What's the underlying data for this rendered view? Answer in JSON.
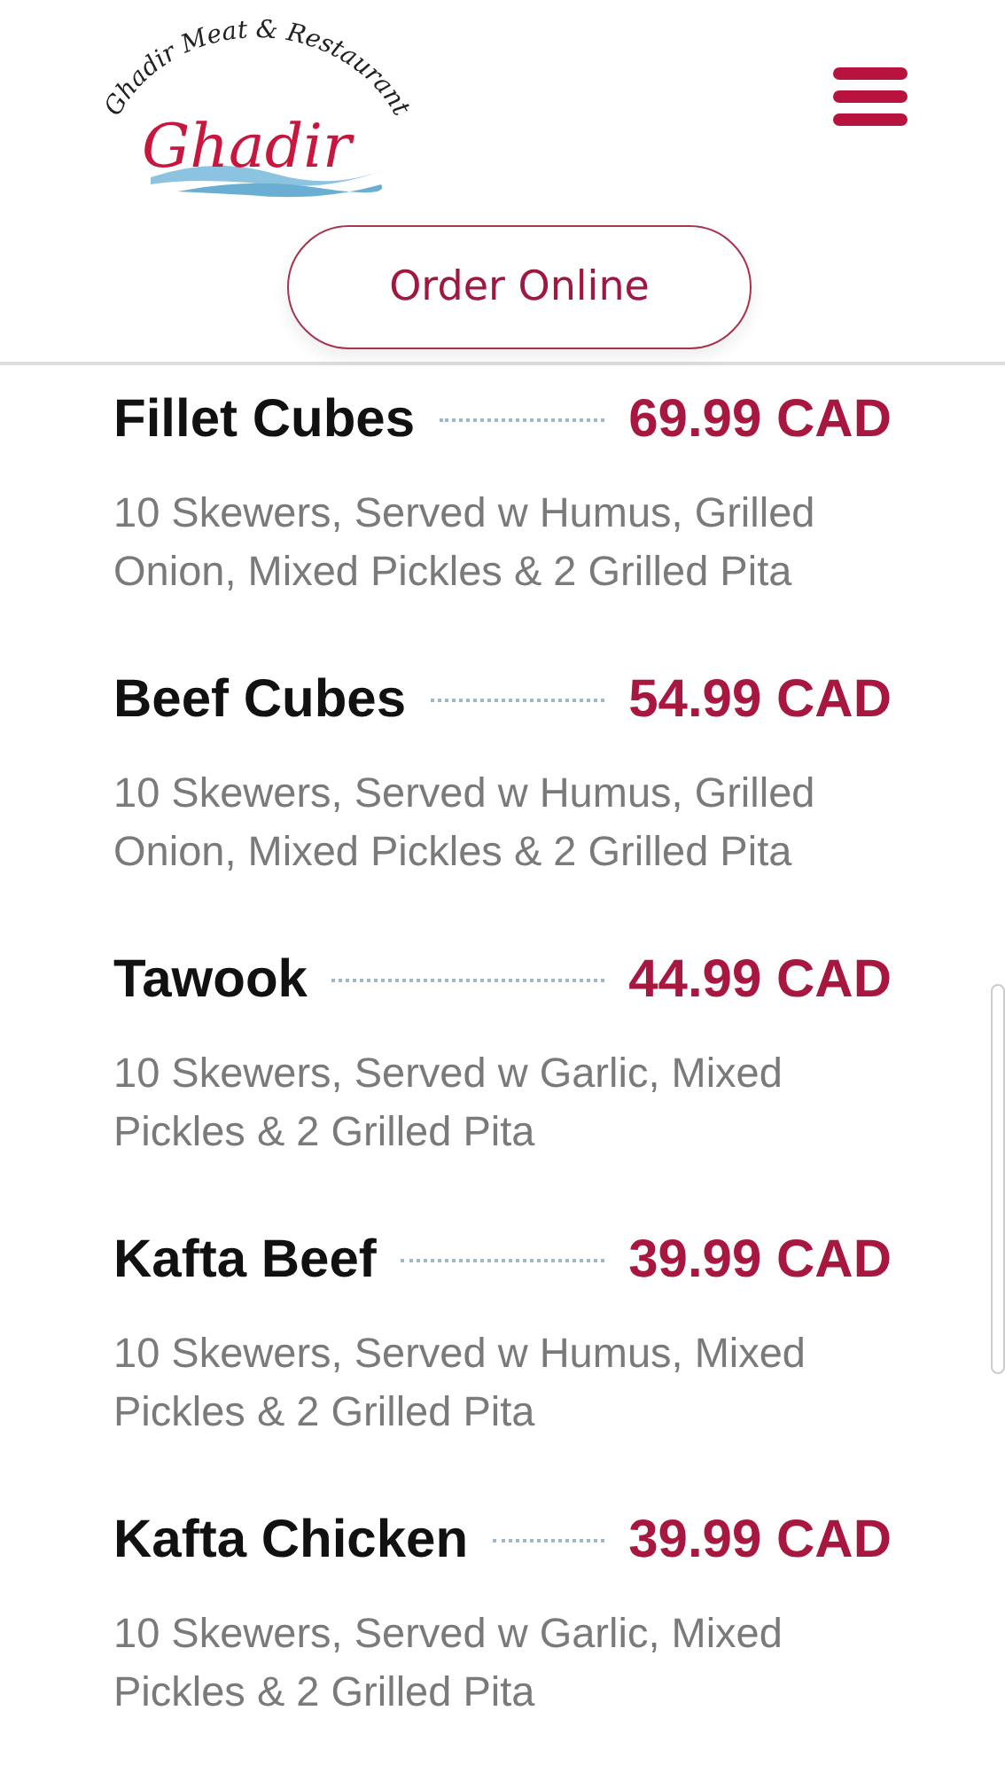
{
  "header": {
    "logo_tagline": "Ghadir Meat & Restaurant",
    "logo_wordmark": "Ghadir",
    "order_button": "Order Online"
  },
  "menu_items": [
    {
      "name": "Fillet Cubes",
      "price": "69.99 CAD",
      "description": "10 Skewers, Served w Humus, Grilled Onion, Mixed Pickles & 2 Grilled Pita"
    },
    {
      "name": "Beef Cubes",
      "price": "54.99 CAD",
      "description": "10 Skewers, Served w Humus, Grilled Onion, Mixed Pickles & 2 Grilled Pita"
    },
    {
      "name": "Tawook",
      "price": "44.99 CAD",
      "description": "10 Skewers, Served w Garlic, Mixed Pickles & 2 Grilled Pita"
    },
    {
      "name": "Kafta Beef",
      "price": "39.99 CAD",
      "description": "10 Skewers, Served w Humus, Mixed Pickles & 2 Grilled Pita"
    },
    {
      "name": "Kafta Chicken",
      "price": "39.99 CAD",
      "description": "10 Skewers, Served w Garlic, Mixed Pickles & 2 Grilled Pita"
    }
  ]
}
